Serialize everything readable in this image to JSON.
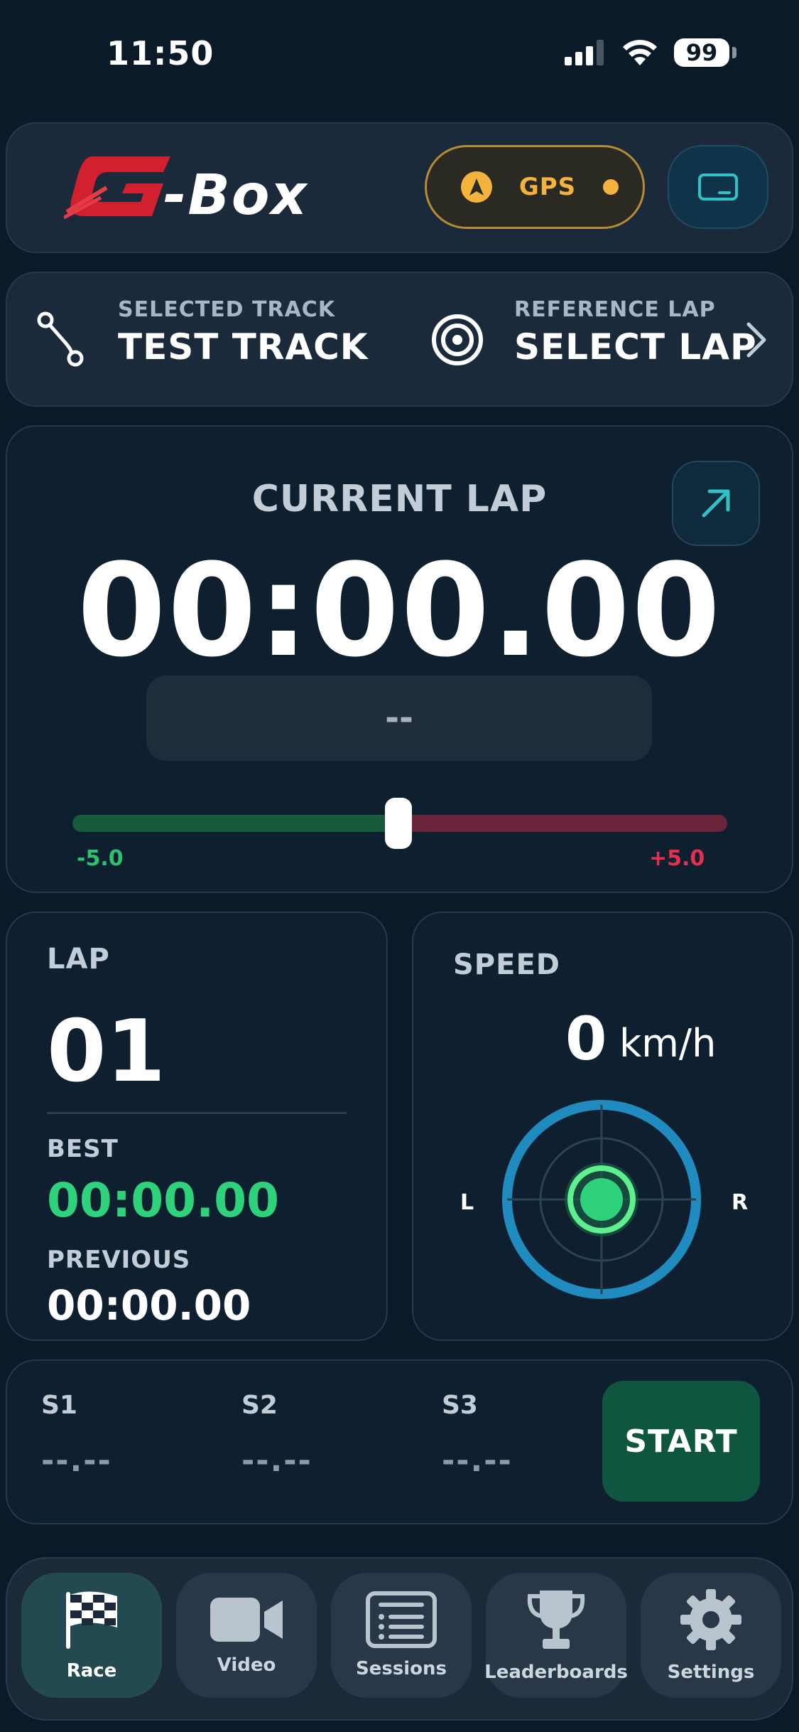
{
  "status_bar": {
    "time": "11:50",
    "battery": "99"
  },
  "header": {
    "logo_text": "-Box",
    "gps_label": "GPS",
    "colors": {
      "gps_accent": "#f3b33c",
      "device_accent": "#2fc3c8"
    }
  },
  "track": {
    "selected_label": "SELECTED TRACK",
    "selected_value": "TEST TRACK",
    "reference_label": "REFERENCE LAP",
    "reference_value": "SELECT LAP"
  },
  "current_lap": {
    "title": "CURRENT LAP",
    "time": "00:00.00",
    "delta": "--",
    "bar_min": "-5.0",
    "bar_max": "+5.0",
    "delta_position": 0.5
  },
  "lap": {
    "title": "LAP",
    "number": "01",
    "best_label": "BEST",
    "best_time": "00:00.00",
    "previous_label": "PREVIOUS",
    "previous_time": "00:00.00"
  },
  "speed": {
    "title": "SPEED",
    "value": "0",
    "unit": "km/h",
    "left_label": "L",
    "right_label": "R"
  },
  "sectors": [
    {
      "label": "S1",
      "value": "--.--"
    },
    {
      "label": "S2",
      "value": "--.--"
    },
    {
      "label": "S3",
      "value": "--.--"
    }
  ],
  "start_button": "START",
  "tabs": [
    {
      "label": "Race",
      "icon": "checkered-flag-icon",
      "active": true
    },
    {
      "label": "Video",
      "icon": "video-camera-icon",
      "active": false
    },
    {
      "label": "Sessions",
      "icon": "sessions-list-icon",
      "active": false
    },
    {
      "label": "Leaderboards",
      "icon": "trophy-icon",
      "active": false
    },
    {
      "label": "Settings",
      "icon": "gear-icon",
      "active": false
    }
  ]
}
